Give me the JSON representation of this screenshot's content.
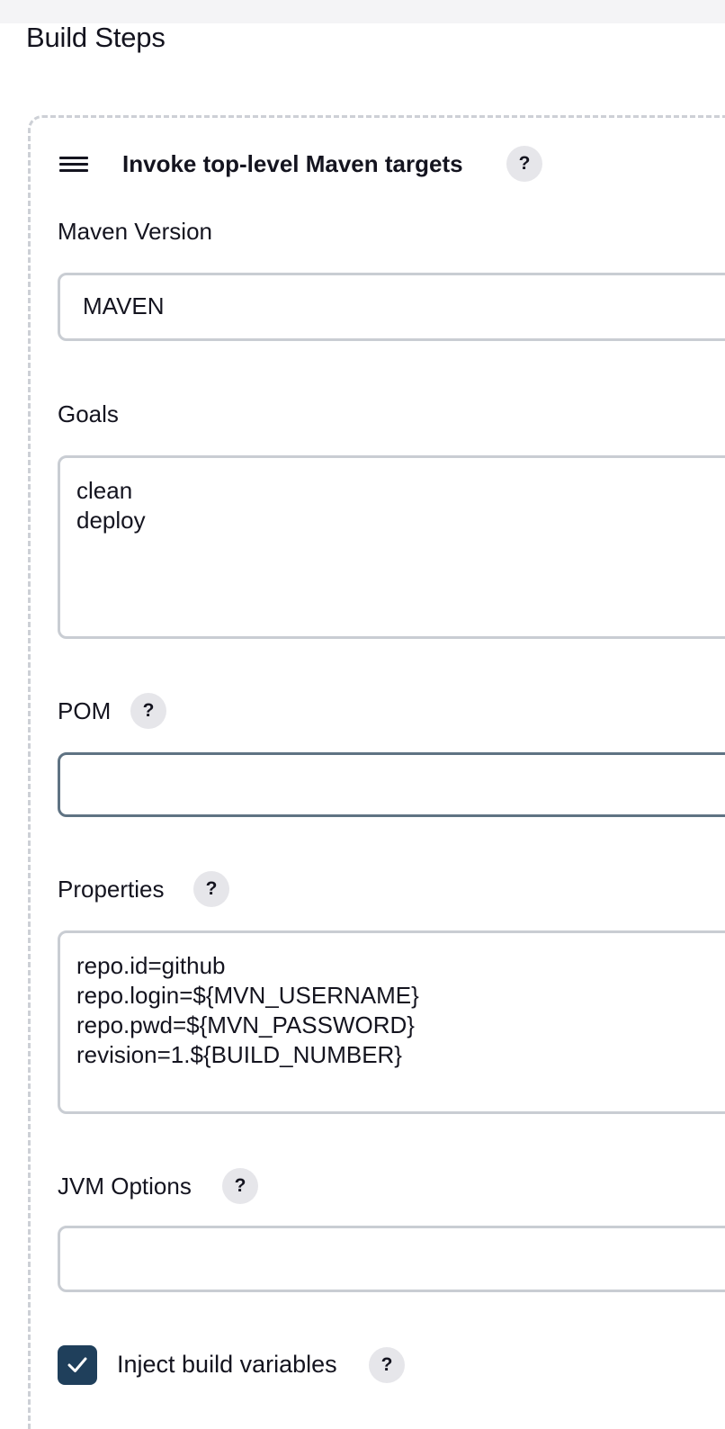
{
  "section": {
    "title": "Build Steps"
  },
  "step": {
    "title": "Invoke top-level Maven targets",
    "drag_handle_icon": "hamburger-icon",
    "help_label": "?",
    "fields": {
      "maven_version": {
        "label": "Maven Version",
        "value": "MAVEN"
      },
      "goals": {
        "label": "Goals",
        "value": "clean\ndeploy"
      },
      "pom": {
        "label": "POM",
        "help_label": "?",
        "value": ""
      },
      "properties": {
        "label": "Properties",
        "help_label": "?",
        "value": "repo.id=github\nrepo.login=${MVN_USERNAME}\nrepo.pwd=${MVN_PASSWORD}\nrevision=1.${BUILD_NUMBER}"
      },
      "jvm_options": {
        "label": "JVM Options",
        "help_label": "?",
        "value": ""
      }
    },
    "inject_build_variables": {
      "label": "Inject build variables",
      "checked": true,
      "help_label": "?"
    }
  },
  "colors": {
    "checkbox": "#1f3f5b",
    "field_border": "#c9cdd3",
    "focused_border": "#5f7383",
    "help_bg": "#e6e6ea"
  }
}
